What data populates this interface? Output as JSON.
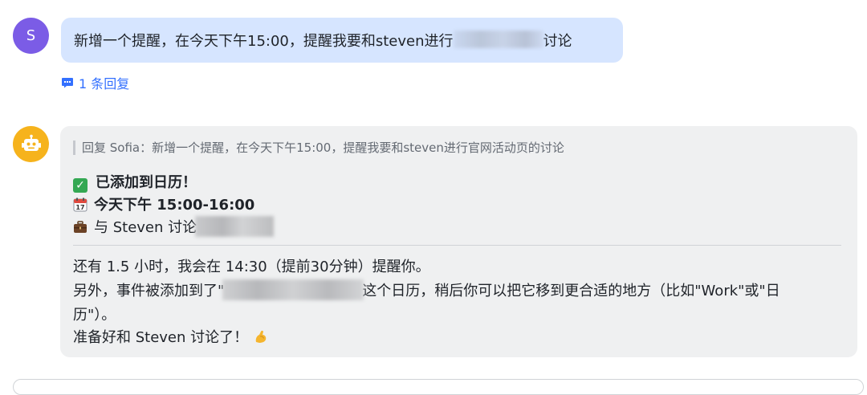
{
  "user": {
    "avatar_initial": "S",
    "message_before": "新增一个提醒，在今天下午15:00，提醒我要和steven进行",
    "message_after": "讨论"
  },
  "reply_link": {
    "label": "1 条回复"
  },
  "bot": {
    "quote": "回复 Sofia：新增一个提醒，在今天下午15:00，提醒我要和steven进行官网活动页的讨论",
    "added_label": "已添加到日历！",
    "time_label": "今天下午 15:00-16:00",
    "event_label": "与 Steven 讨论",
    "para1": "还有 1.5 小时，我会在 14:30（提前30分钟）提醒你。",
    "para2_before": "另外，事件被添加到了\"",
    "para2_after": "这个日历，稍后你可以把它移到更合适的地方（比如\"Work\"或\"日",
    "para3": "历\"）。",
    "para4": "准备好和 Steven 讨论了！"
  },
  "colors": {
    "user_avatar": "#7b5ce6",
    "user_bubble": "#d6e5ff",
    "bot_avatar": "#f6b31c",
    "bot_card": "#eff0f1",
    "link": "#3370ff"
  },
  "icons": [
    "reply-comment-icon",
    "robot-icon",
    "check-icon",
    "calendar-icon",
    "briefcase-icon",
    "flexed-arm-icon"
  ]
}
